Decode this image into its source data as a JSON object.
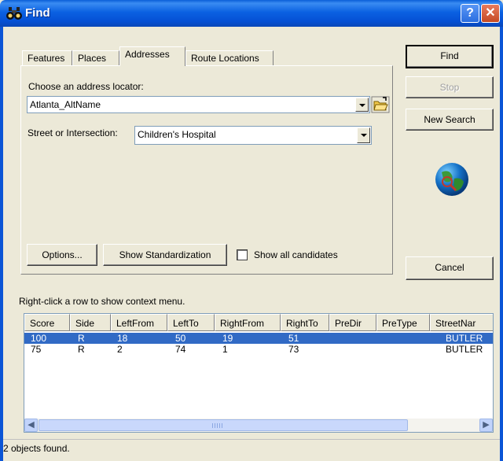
{
  "window": {
    "title": "Find",
    "help": "?",
    "close": "✕"
  },
  "tabs": [
    {
      "label": "Features",
      "active": false
    },
    {
      "label": "Places",
      "active": false
    },
    {
      "label": "Addresses",
      "active": true
    },
    {
      "label": "Route Locations",
      "active": false
    }
  ],
  "addresses": {
    "locator_label": "Choose an address locator:",
    "locator_value": "Atlanta_AltName",
    "street_label": "Street or Intersection:",
    "street_value": "Children's Hospital"
  },
  "buttons": {
    "options": "Options...",
    "show_standardization": "Show Standardization",
    "show_all_candidates": "Show all candidates",
    "find": "Find",
    "stop": "Stop",
    "new_search": "New Search",
    "cancel": "Cancel"
  },
  "hint": "Right-click a row to show context menu.",
  "table": {
    "columns": [
      "Score",
      "Side",
      "LeftFrom",
      "LeftTo",
      "RightFrom",
      "RightTo",
      "PreDir",
      "PreType",
      "StreetNar"
    ],
    "rows": [
      {
        "selected": true,
        "cells": [
          "100",
          "R",
          "18",
          "50",
          "19",
          "51",
          "",
          "",
          "BUTLER"
        ]
      },
      {
        "selected": false,
        "cells": [
          "75",
          "R",
          "2",
          "74",
          "1",
          "73",
          "",
          "",
          "BUTLER"
        ]
      }
    ]
  },
  "status": "2 objects found.",
  "colors": {
    "titlebar": "#0550d4",
    "selection": "#316ac5",
    "face": "#ece9d8"
  }
}
